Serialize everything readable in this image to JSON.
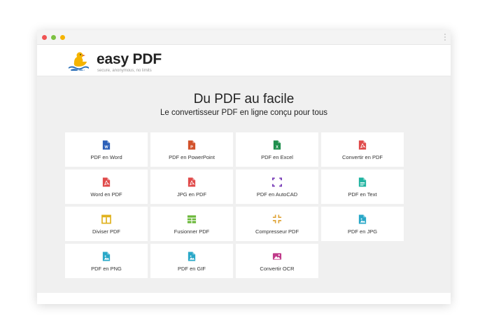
{
  "brand": {
    "name": "easy PDF",
    "tagline": "secure, anonymous, no limits"
  },
  "hero": {
    "title": "Du PDF au facile",
    "subtitle": "Le convertisseur PDF en ligne conçu pour tous"
  },
  "tools": [
    {
      "label": "PDF en Word",
      "icon": "word-file-icon",
      "color": "#2b5fb8"
    },
    {
      "label": "PDF en PowerPoint",
      "icon": "powerpoint-file-icon",
      "color": "#d2512a"
    },
    {
      "label": "PDF en Excel",
      "icon": "excel-file-icon",
      "color": "#1f8f4d"
    },
    {
      "label": "Convertir en PDF",
      "icon": "pdf-file-icon",
      "color": "#e04a4a"
    },
    {
      "label": "Word en PDF",
      "icon": "pdf-file-icon",
      "color": "#e04a4a"
    },
    {
      "label": "JPG en PDF",
      "icon": "pdf-file-icon",
      "color": "#e04a4a"
    },
    {
      "label": "PDF en AutoCAD",
      "icon": "expand-corners-icon",
      "color": "#7a3fb8"
    },
    {
      "label": "PDF en Text",
      "icon": "text-file-icon",
      "color": "#1fb3a0"
    },
    {
      "label": "Diviser PDF",
      "icon": "split-columns-icon",
      "color": "#e0b21f"
    },
    {
      "label": "Fusionner PDF",
      "icon": "merge-grid-icon",
      "color": "#6bb83a"
    },
    {
      "label": "Compresseur PDF",
      "icon": "compress-arrows-icon",
      "color": "#e0a53a"
    },
    {
      "label": "PDF en JPG",
      "icon": "image-file-icon",
      "color": "#2aa8c8"
    },
    {
      "label": "PDF en PNG",
      "icon": "image-file-icon",
      "color": "#2aa8c8"
    },
    {
      "label": "PDF en GIF",
      "icon": "image-file-icon",
      "color": "#2aa8c8"
    },
    {
      "label": "Convertir OCR",
      "icon": "ocr-image-icon",
      "color": "#c03a8a"
    }
  ],
  "colors": {
    "background": "#f0f0f0",
    "tile": "#ffffff",
    "duck": "#f5b400",
    "water": "#2a6fb8"
  }
}
